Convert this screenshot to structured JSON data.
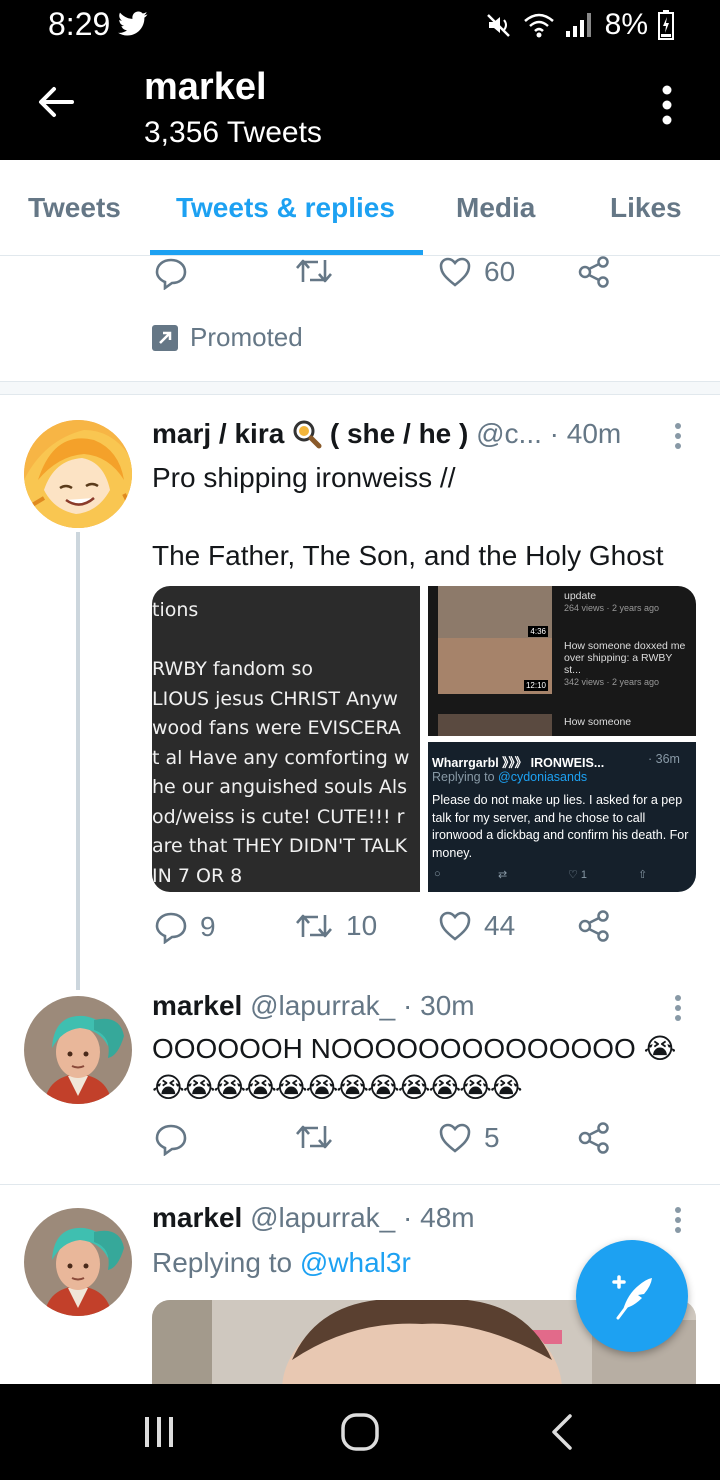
{
  "status_bar": {
    "time": "8:29",
    "battery": "8%"
  },
  "header": {
    "name": "markel",
    "tweet_count": "3,356 Tweets"
  },
  "tabs": [
    {
      "label": "Tweets",
      "active": false
    },
    {
      "label": "Tweets & replies",
      "active": true
    },
    {
      "label": "Media",
      "active": false
    },
    {
      "label": "Likes",
      "active": false
    }
  ],
  "promoted_tweet": {
    "like_count": "60",
    "promoted_label": "Promoted"
  },
  "tweets": [
    {
      "display_name": "marj / kira",
      "name_suffix": "( she / he )",
      "handle": "@c...",
      "time": "· 40m",
      "text_line1": "Pro shipping ironweiss //",
      "text_line2": "The Father, The Son, and the Holy Ghost",
      "reply_count": "9",
      "retweet_count": "10",
      "like_count": "44",
      "media_text": [
        "tions",
        "",
        "RWBY fandom so",
        "LIOUS jesus CHRIST Anyw",
        "wood fans were EVISCERA",
        "t al Have any comforting w",
        "he our anguished souls Als",
        "od/weiss is cute! CUTE!!! r",
        "are that THEY DIDN'T TALK",
        "IN 7 OR 8"
      ],
      "media_videos": [
        {
          "title": "update",
          "meta": "264 views · 2 years ago",
          "duration": "4:36"
        },
        {
          "title": "How someone doxxed me over shipping: a RWBY st...",
          "meta": "342 views · 2 years ago",
          "duration": "12:10"
        },
        {
          "title": "How someone",
          "meta": "",
          "duration": ""
        }
      ],
      "media_quote": {
        "name": "Wharrgarbl 》》》 IRONWEIS...",
        "time": "· 36m",
        "replying_prefix": "Replying to",
        "replying_handle": "@cydoniasands",
        "text": "Please do not make up lies. I asked for a pep talk for my server, and he chose to call ironwood a dickbag and confirm his death. For money.",
        "like_count": "1"
      }
    },
    {
      "display_name": "markel",
      "handle": "@lapurrak_",
      "time": "· 30m",
      "text_line1": "OOOOOOH NOOOOOOOOOOOOOO 😭",
      "text_line2": "😭😭😭😭😭😭😭😭😭😭😭😭",
      "like_count": "5"
    },
    {
      "display_name": "markel",
      "handle": "@lapurrak_",
      "time": "· 48m",
      "replying_prefix": "Replying to",
      "replying_handle": "@whal3r"
    }
  ],
  "colors": {
    "accent": "#1da1f2",
    "secondary_text": "#657786",
    "header_bg": "#000000"
  },
  "icons": [
    "twitter-bird-icon",
    "mute-icon",
    "wifi-icon",
    "signal-icon",
    "battery-charging-icon",
    "back-arrow-icon",
    "overflow-menu-icon",
    "reply-icon",
    "retweet-icon",
    "like-icon",
    "share-icon",
    "promoted-icon",
    "magnifier-emoji-icon",
    "compose-tweet-icon",
    "recent-apps-icon",
    "home-icon",
    "nav-back-icon"
  ]
}
